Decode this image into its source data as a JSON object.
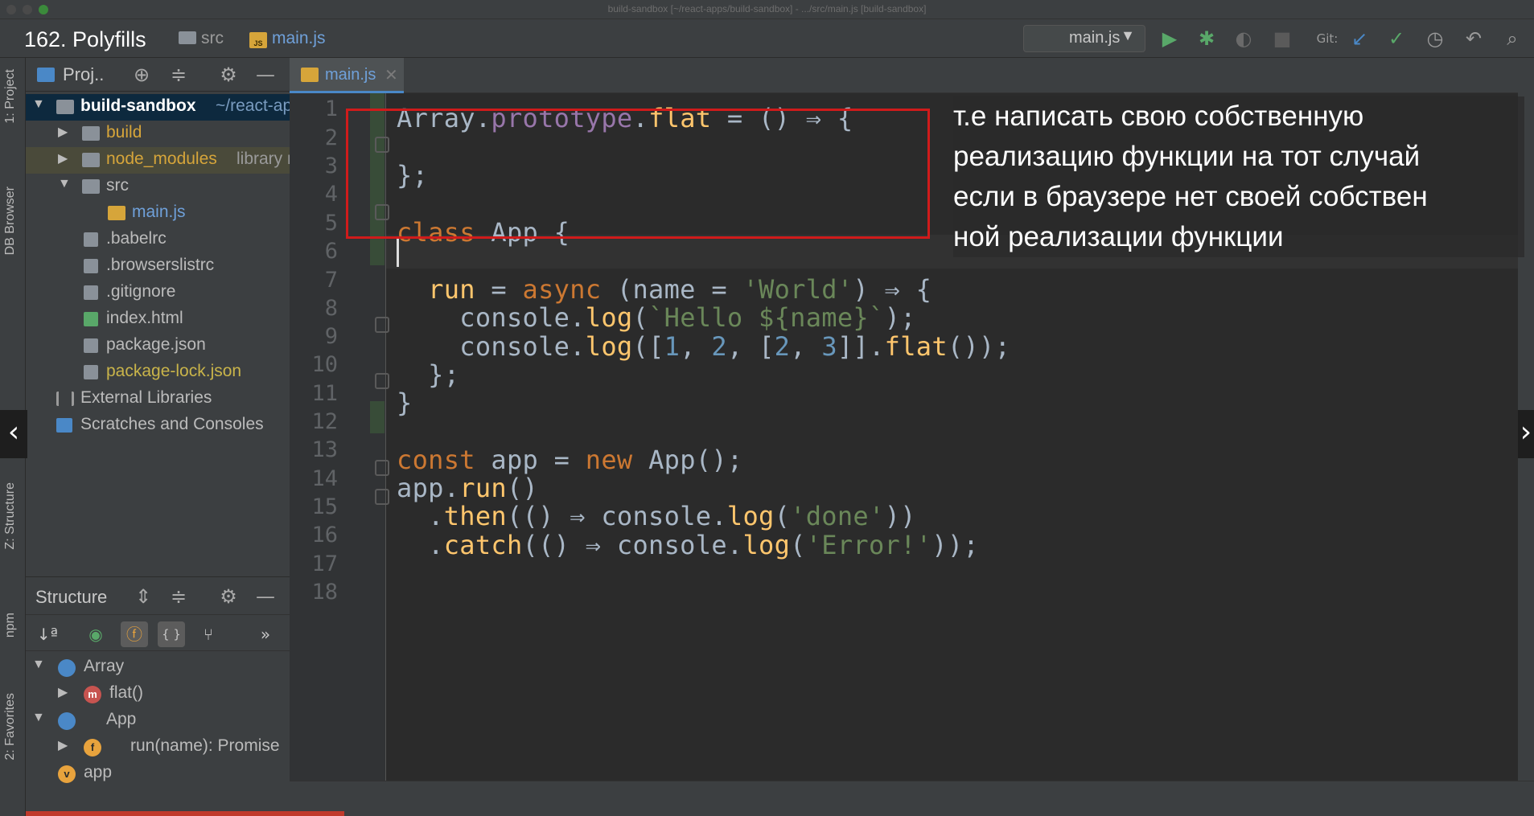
{
  "window": {
    "title": "build-sandbox [~/react-apps/build-sandbox] - .../src/main.js [build-sandbox]"
  },
  "lecture": {
    "title": "162. Polyfills"
  },
  "breadcrumbs": [
    "src",
    "main.js"
  ],
  "run_config": {
    "label": "main.js"
  },
  "vcs_label": "Git:",
  "tool_windows": {
    "left": [
      "1: Project",
      "DB Browser",
      "Z: Structure",
      "npm",
      "2: Favorites"
    ]
  },
  "project": {
    "header_title": "Proj..",
    "tree": [
      {
        "label": "build-sandbox",
        "suffix": "~/react-apps/build-sandbox",
        "depth": 0,
        "expanded": true,
        "type": "folder"
      },
      {
        "label": "build",
        "suffix": "",
        "depth": 1,
        "expanded": false,
        "type": "folder"
      },
      {
        "label": "node_modules",
        "suffix": "library root",
        "depth": 1,
        "expanded": false,
        "type": "folder"
      },
      {
        "label": "src",
        "suffix": "",
        "depth": 1,
        "expanded": true,
        "type": "folder"
      },
      {
        "label": "main.js",
        "suffix": "",
        "depth": 2,
        "type": "js"
      },
      {
        "label": ".babelrc",
        "suffix": "",
        "depth": 1,
        "type": "config"
      },
      {
        "label": ".browserslistrc",
        "suffix": "",
        "depth": 1,
        "type": "file"
      },
      {
        "label": ".gitignore",
        "suffix": "",
        "depth": 1,
        "type": "file"
      },
      {
        "label": "index.html",
        "suffix": "",
        "depth": 1,
        "type": "html"
      },
      {
        "label": "package.json",
        "suffix": "",
        "depth": 1,
        "type": "config"
      },
      {
        "label": "package-lock.json",
        "suffix": "",
        "depth": 1,
        "type": "config"
      },
      {
        "label": "External Libraries",
        "suffix": "",
        "depth": 0,
        "type": "lib"
      },
      {
        "label": "Scratches and Consoles",
        "suffix": "",
        "depth": 0,
        "type": "scratch"
      }
    ]
  },
  "structure": {
    "title": "Structure",
    "overflow": "»",
    "items": [
      {
        "label": "Array",
        "badge": "JS",
        "expanded": true
      },
      {
        "label": "flat()",
        "badge": "m",
        "expanded": false
      },
      {
        "label": "App",
        "badge": "JS",
        "expanded": true
      },
      {
        "label": "run(name): Promise",
        "badge": "f",
        "expanded": false
      },
      {
        "label": "app",
        "badge": "v",
        "expanded": null
      }
    ]
  },
  "editor": {
    "tab": "main.js",
    "line_numbers": [
      "1",
      "2",
      "3",
      "4",
      "5",
      "6",
      "7",
      "8",
      "9",
      "10",
      "11",
      "12",
      "13",
      "14",
      "15",
      "16",
      "17",
      "18"
    ],
    "code": {
      "l2": [
        "Array.",
        "prototype",
        ".",
        "flat",
        " = () ⇒ {"
      ],
      "l4": [
        "};"
      ],
      "l6": [
        "class",
        " App {"
      ],
      "l8": [
        "  run",
        " = ",
        "async",
        " (name = ",
        "'World'",
        ") ⇒ {"
      ],
      "l9": [
        "    console.",
        "log",
        "(",
        "`Hello ${name}`",
        ");"
      ],
      "l10": [
        "    console.",
        "log",
        "([",
        "1",
        ", ",
        "2",
        ", [",
        "2",
        ", ",
        "3",
        "]].",
        "flat",
        "());"
      ],
      "l11": [
        "  };"
      ],
      "l12": [
        "}"
      ],
      "l14": [
        "const",
        " app = ",
        "new",
        " App();"
      ],
      "l15": [
        "app.",
        "run",
        "()"
      ],
      "l16": [
        "  .",
        "then",
        "(() ⇒ console.",
        "log",
        "(",
        "'done'",
        "))"
      ],
      "l17": [
        "  .",
        "catch",
        "(() ⇒ console.",
        "log",
        "(",
        "'Error!'",
        "));"
      ]
    }
  },
  "annotation": {
    "lines": [
      "т.е написать свою собственную",
      "реализацию функции на тот случай",
      "если в браузере нет своей собствен",
      "ной реализации функции"
    ]
  },
  "colors": {
    "keyword": "#cc7832",
    "property": "#9876aa",
    "function": "#ffc66d",
    "string": "#6a8759",
    "number": "#6897bb",
    "highlight_box": "#d01b1b",
    "selection": "#0d293e"
  }
}
